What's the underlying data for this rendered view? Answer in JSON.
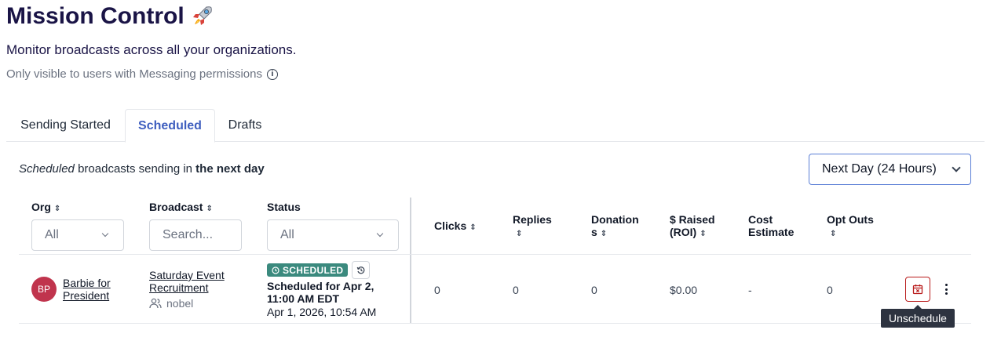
{
  "page": {
    "title": "Mission Control",
    "title_emoji": "rocket",
    "subtitle": "Monitor broadcasts across all your organizations.",
    "permission_note": "Only visible to users with Messaging permissions"
  },
  "tabs": [
    {
      "label": "Sending Started",
      "active": false
    },
    {
      "label": "Scheduled",
      "active": true
    },
    {
      "label": "Drafts",
      "active": false
    }
  ],
  "description": {
    "prefix_italic": "Scheduled",
    "middle": " broadcasts sending in ",
    "suffix_bold": "the next day"
  },
  "range_select": {
    "value": "Next Day (24 Hours)"
  },
  "columns": {
    "org": "Org",
    "broadcast": "Broadcast",
    "status": "Status",
    "clicks": "Clicks",
    "replies": "Replies",
    "donations_line1": "Donation",
    "donations_line2": "s",
    "raised_line1": "$ Raised",
    "raised_line2": "(ROI)",
    "cost_line1": "Cost",
    "cost_line2": "Estimate",
    "optouts": "Opt Outs"
  },
  "filters": {
    "org": "All",
    "broadcast_placeholder": "Search...",
    "status": "All"
  },
  "row": {
    "org_initials": "BP",
    "org_name_line1": "Barbie for",
    "org_name_line2": "President",
    "broadcast_line1": "Saturday Event",
    "broadcast_line2": "Recruitment",
    "author": "nobel",
    "status_badge": "SCHEDULED",
    "scheduled_line1": "Scheduled for Apr 2,",
    "scheduled_line2": "11:00 AM EDT",
    "created_at": "Apr 1, 2026, 10:54 AM",
    "clicks": "0",
    "replies": "0",
    "donations": "0",
    "raised": "$0.00",
    "cost": "-",
    "optouts": "0"
  },
  "tooltip": "Unschedule",
  "colors": {
    "brand_title": "#1a1446",
    "tab_active": "#3f5fbf",
    "badge_bg": "#3b8a7e",
    "avatar_bg": "#c0344d",
    "unschedule_border": "#b91c1c",
    "tooltip_bg": "#2d3340"
  }
}
